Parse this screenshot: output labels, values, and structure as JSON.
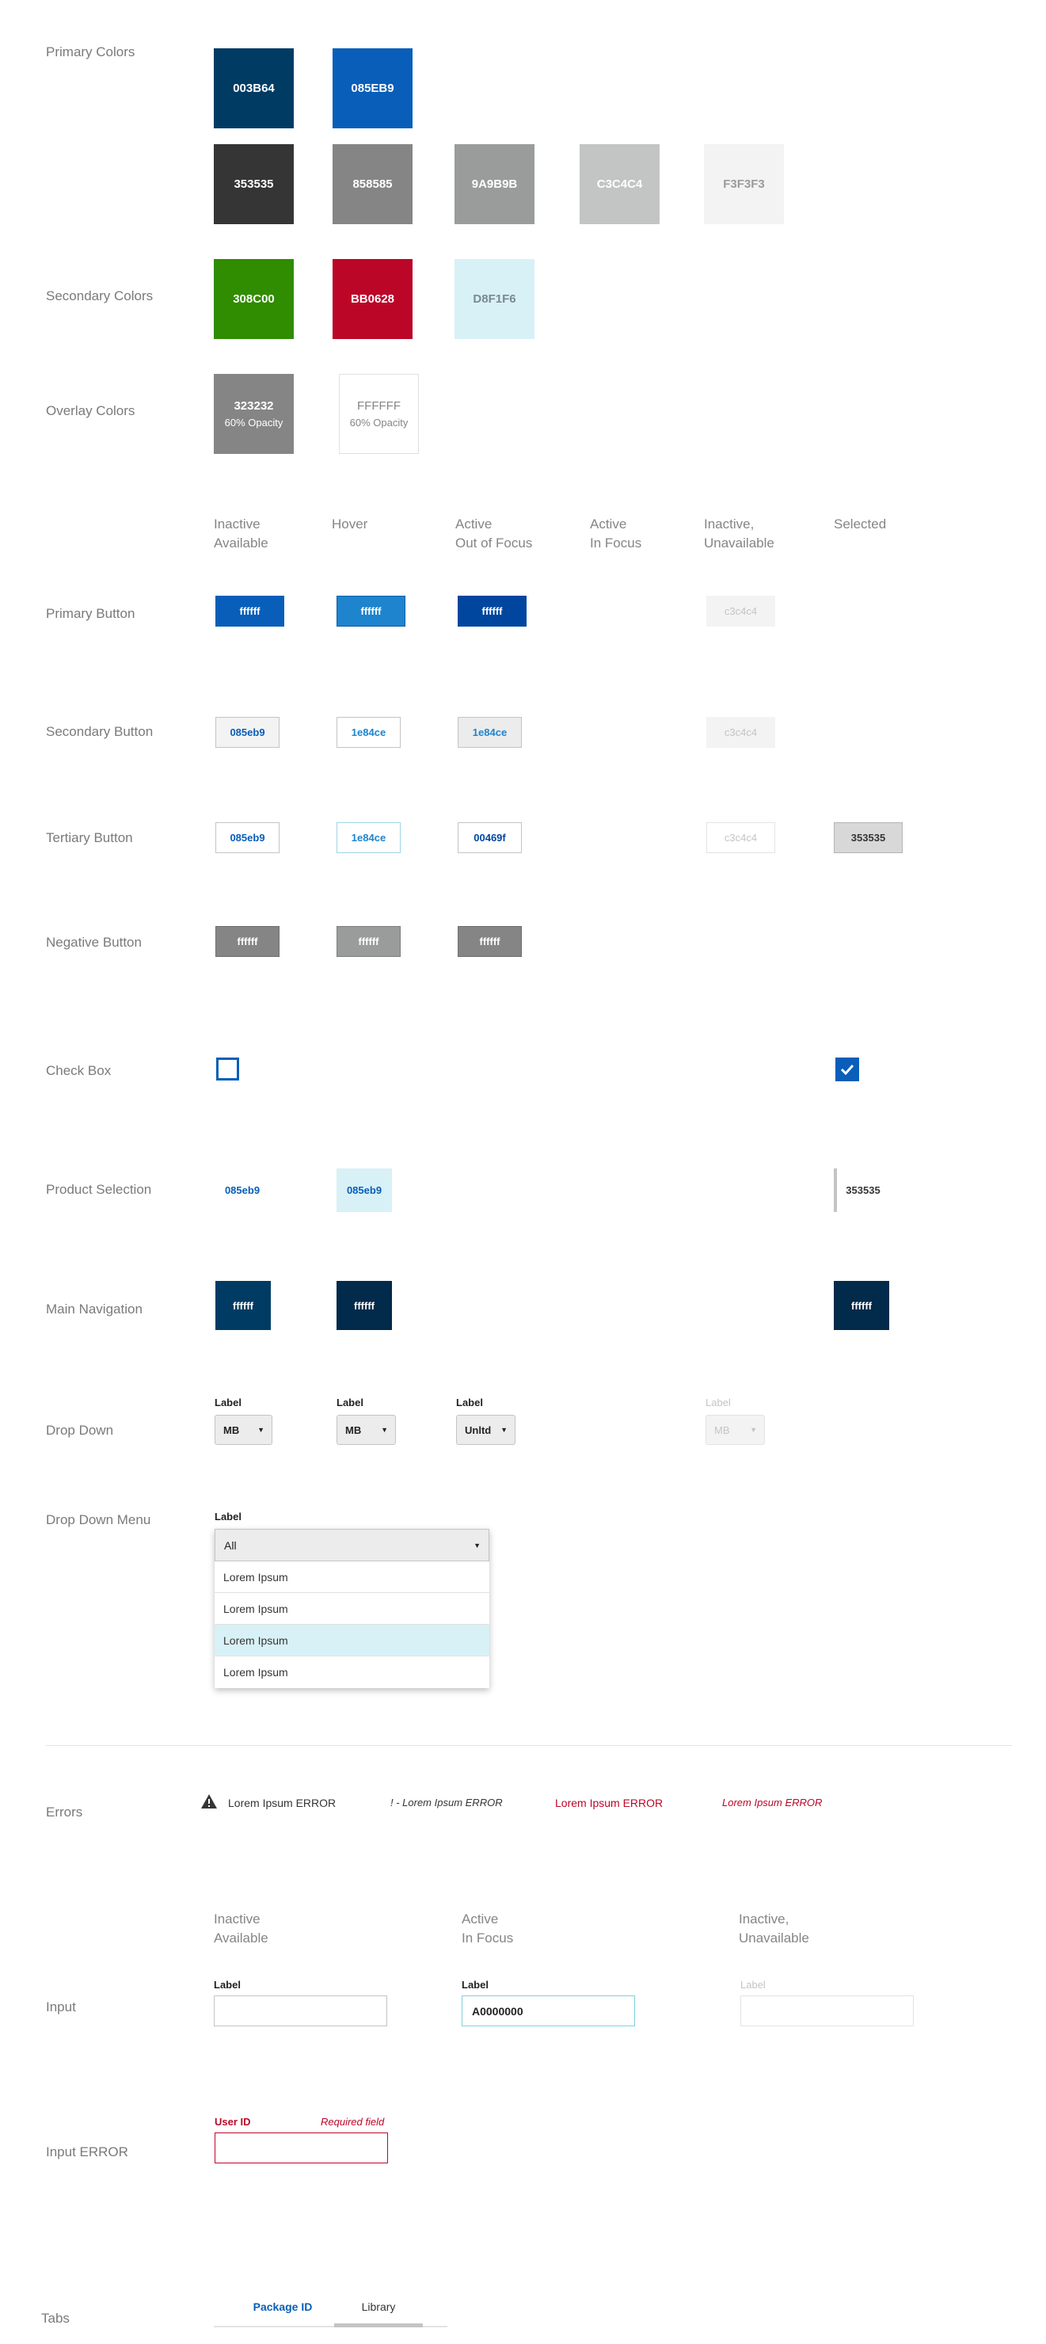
{
  "colors": {
    "rows": {
      "primary": "Primary Colors",
      "secondary": "Secondary Colors",
      "overlay": "Overlay Colors"
    },
    "primary": [
      "003B64",
      "085EB9"
    ],
    "grays": [
      "353535",
      "858585",
      "9A9B9B",
      "C3C4C4",
      "F3F3F3"
    ],
    "secondary": [
      "308C00",
      "BB0628",
      "D8F1F6"
    ],
    "overlay": [
      {
        "value": "323232",
        "note": "60% Opacity"
      },
      {
        "value": "FFFFFF",
        "note": "60% Opacity"
      }
    ]
  },
  "states": {
    "inactive": [
      "Inactive",
      "Available"
    ],
    "hover": [
      "Hover"
    ],
    "active_out": [
      "Active",
      "Out of Focus"
    ],
    "active_in": [
      "Active",
      "In Focus"
    ],
    "unavailable": [
      "Inactive,",
      "Unavailable"
    ],
    "selected": [
      "Selected"
    ]
  },
  "rows": {
    "primary_button": "Primary Button",
    "secondary_button": "Secondary Button",
    "tertiary_button": "Tertiary Button",
    "negative_button": "Negative Button",
    "check_box": "Check Box",
    "product_selection": "Product Selection",
    "main_navigation": "Main Navigation",
    "drop_down": "Drop Down",
    "drop_down_menu": "Drop Down Menu",
    "errors": "Errors",
    "input": "Input",
    "input_error": "Input ERROR",
    "tabs": "Tabs"
  },
  "primary_button": {
    "inactive": "ffffff",
    "hover": "ffffff",
    "active": "ffffff",
    "unavailable": "c3c4c4"
  },
  "secondary_button": {
    "inactive": "085eb9",
    "hover": "1e84ce",
    "active": "1e84ce",
    "unavailable": "c3c4c4"
  },
  "tertiary_button": {
    "inactive": "085eb9",
    "hover": "1e84ce",
    "active": "00469f",
    "unavailable": "c3c4c4",
    "selected": "353535"
  },
  "negative_button": {
    "inactive": "ffffff",
    "hover": "ffffff",
    "active": "ffffff"
  },
  "product_selection": {
    "inactive": "085eb9",
    "hover": "085eb9",
    "selected": "353535"
  },
  "main_navigation": {
    "inactive": "ffffff",
    "hover": "ffffff",
    "selected": "ffffff"
  },
  "drop_down": [
    {
      "label": "Label",
      "value": "MB"
    },
    {
      "label": "Label",
      "value": "MB"
    },
    {
      "label": "Label",
      "value": "Unltd"
    },
    {
      "label": "Label",
      "value": "MB"
    }
  ],
  "drop_down_menu": {
    "label": "Label",
    "value": "All",
    "items": [
      "Lorem Ipsum",
      "Lorem Ipsum",
      "Lorem Ipsum",
      "Lorem Ipsum"
    ]
  },
  "errors": [
    "Lorem Ipsum ERROR",
    "! - Lorem Ipsum ERROR",
    "Lorem Ipsum ERROR",
    "Lorem Ipsum ERROR"
  ],
  "input": {
    "heads": {
      "inactive": [
        "Inactive",
        "Available"
      ],
      "active": [
        "Active",
        "In Focus"
      ],
      "unavailable": [
        "Inactive,",
        "Unavailable"
      ]
    },
    "fields": [
      {
        "label": "Label",
        "value": ""
      },
      {
        "label": "Label",
        "value": "A0000000"
      },
      {
        "label": "Label",
        "value": ""
      }
    ]
  },
  "input_error": {
    "label": "User ID",
    "message": "Required field",
    "value": ""
  },
  "tabs": [
    "Package ID",
    "Library"
  ]
}
